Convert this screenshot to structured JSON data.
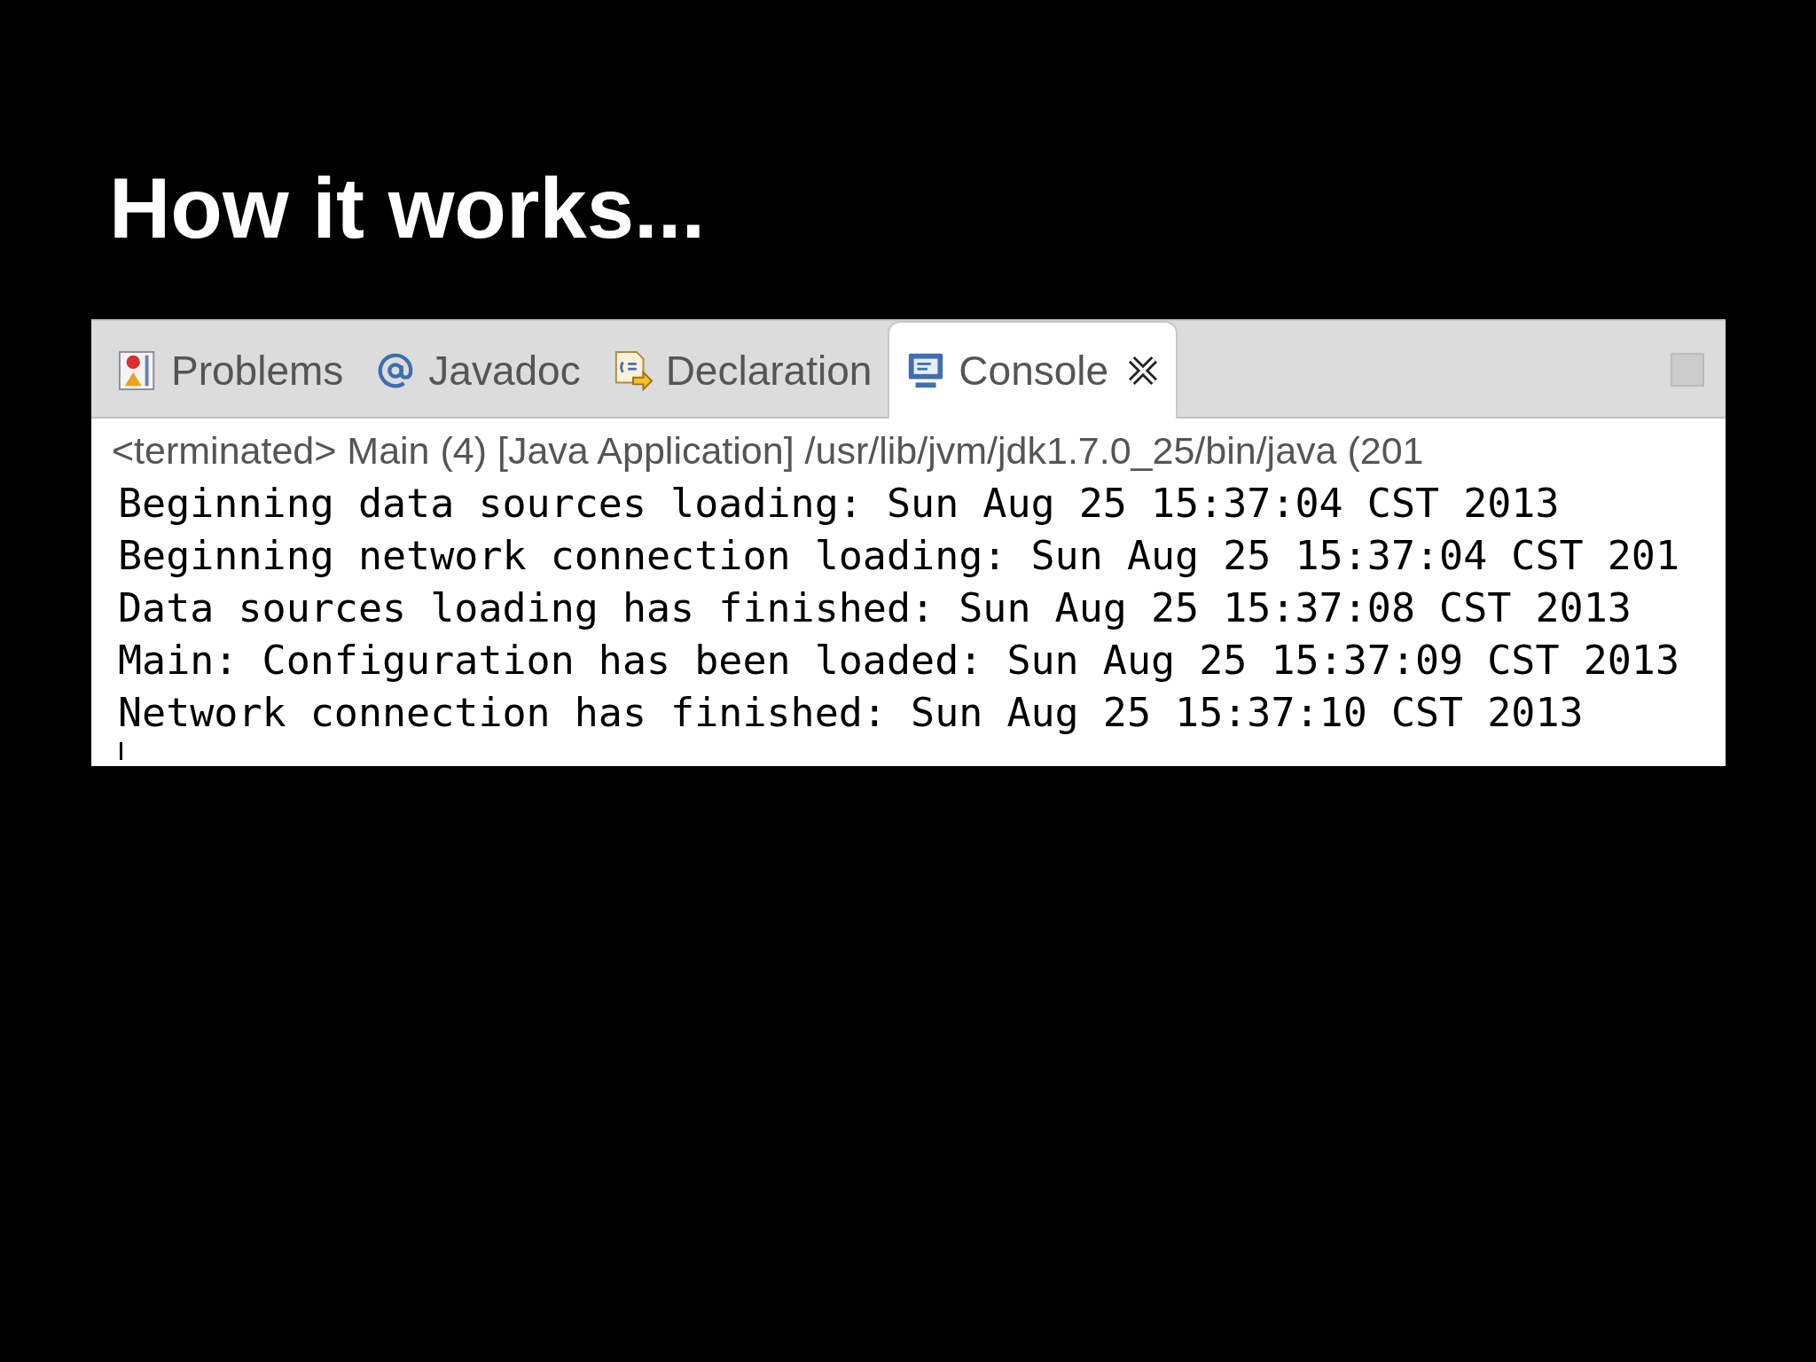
{
  "slide": {
    "title": "How it works..."
  },
  "tabs": [
    {
      "label": "Problems",
      "kind": "problems",
      "selected": false,
      "closable": false
    },
    {
      "label": "Javadoc",
      "kind": "javadoc",
      "selected": false,
      "closable": false
    },
    {
      "label": "Declaration",
      "kind": "declaration",
      "selected": false,
      "closable": false
    },
    {
      "label": "Console",
      "kind": "console",
      "selected": true,
      "closable": true
    }
  ],
  "console": {
    "header": "<terminated> Main (4) [Java Application] /usr/lib/jvm/jdk1.7.0_25/bin/java (201",
    "lines": [
      "Beginning data sources loading: Sun Aug 25 15:37:04 CST 2013",
      "Beginning network connection loading: Sun Aug 25 15:37:04 CST 201",
      "Data sources loading has finished: Sun Aug 25 15:37:08 CST 2013",
      "Main: Configuration has been loaded: Sun Aug 25 15:37:09 CST 2013",
      "Network connection has finished: Sun Aug 25 15:37:10 CST 2013"
    ]
  }
}
